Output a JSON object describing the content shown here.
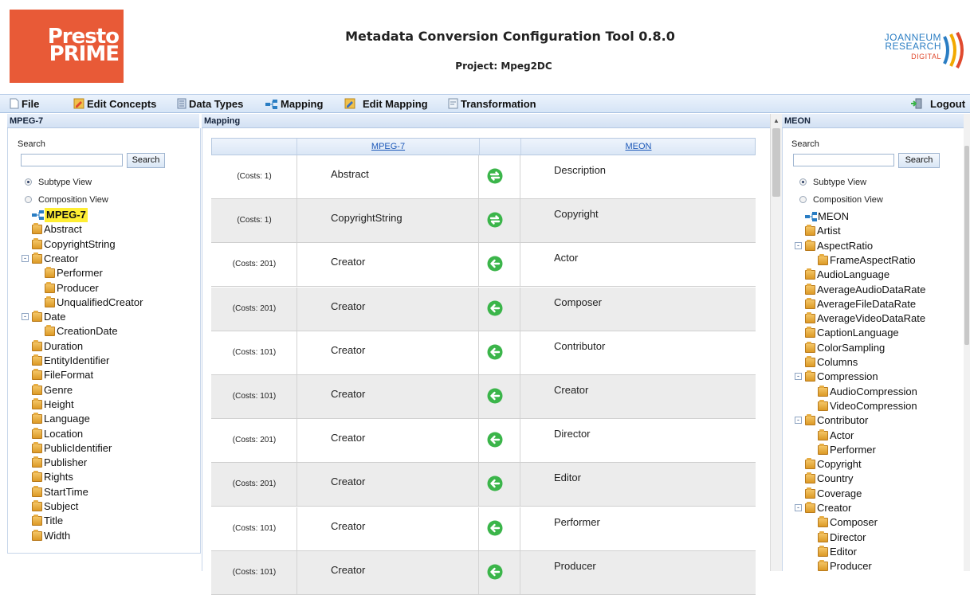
{
  "header": {
    "logo_left": [
      "Presto",
      "PRIME"
    ],
    "title": "Metadata Conversion Configuration Tool 0.8.0",
    "project": "Project: Mpeg2DC",
    "logo_right": [
      "JOANNEUM",
      "RESEARCH",
      "DIGITAL"
    ]
  },
  "toolbar": {
    "file": "File",
    "edit_concepts": "Edit Concepts",
    "data_types": "Data Types",
    "mapping": "Mapping",
    "edit_mapping": "Edit Mapping",
    "transformation": "Transformation",
    "logout": "Logout"
  },
  "left_panel": {
    "title": "MPEG-7",
    "search_label": "Search",
    "search_value": "",
    "search_button": "Search",
    "view_subtype": "Subtype View",
    "view_composition": "Composition View",
    "selected_view": "Subtype View",
    "root": "MPEG-7",
    "items": [
      {
        "label": "Abstract",
        "level": 1,
        "toggle": ""
      },
      {
        "label": "CopyrightString",
        "level": 1,
        "toggle": ""
      },
      {
        "label": "Creator",
        "level": 1,
        "toggle": "-"
      },
      {
        "label": "Performer",
        "level": 2,
        "toggle": ""
      },
      {
        "label": "Producer",
        "level": 2,
        "toggle": ""
      },
      {
        "label": "UnqualifiedCreator",
        "level": 2,
        "toggle": ""
      },
      {
        "label": "Date",
        "level": 1,
        "toggle": "-"
      },
      {
        "label": "CreationDate",
        "level": 2,
        "toggle": ""
      },
      {
        "label": "Duration",
        "level": 1,
        "toggle": ""
      },
      {
        "label": "EntityIdentifier",
        "level": 1,
        "toggle": ""
      },
      {
        "label": "FileFormat",
        "level": 1,
        "toggle": ""
      },
      {
        "label": "Genre",
        "level": 1,
        "toggle": ""
      },
      {
        "label": "Height",
        "level": 1,
        "toggle": ""
      },
      {
        "label": "Language",
        "level": 1,
        "toggle": ""
      },
      {
        "label": "Location",
        "level": 1,
        "toggle": ""
      },
      {
        "label": "PublicIdentifier",
        "level": 1,
        "toggle": ""
      },
      {
        "label": "Publisher",
        "level": 1,
        "toggle": ""
      },
      {
        "label": "Rights",
        "level": 1,
        "toggle": ""
      },
      {
        "label": "StartTime",
        "level": 1,
        "toggle": ""
      },
      {
        "label": "Subject",
        "level": 1,
        "toggle": ""
      },
      {
        "label": "Title",
        "level": 1,
        "toggle": ""
      },
      {
        "label": "Width",
        "level": 1,
        "toggle": ""
      }
    ]
  },
  "mapping_panel": {
    "title": "Mapping",
    "col_source": "MPEG-7",
    "col_target": "MEON",
    "rows": [
      {
        "cost": "(Costs: 1)",
        "source": "Abstract",
        "target": "Description",
        "kind": "bidirectional"
      },
      {
        "cost": "(Costs: 1)",
        "source": "CopyrightString",
        "target": "Copyright",
        "kind": "bidirectional"
      },
      {
        "cost": "(Costs: 201)",
        "source": "Creator",
        "target": "Actor",
        "kind": "left"
      },
      {
        "cost": "(Costs: 201)",
        "source": "Creator",
        "target": "Composer",
        "kind": "left"
      },
      {
        "cost": "(Costs: 101)",
        "source": "Creator",
        "target": "Contributor",
        "kind": "left"
      },
      {
        "cost": "(Costs: 101)",
        "source": "Creator",
        "target": "Creator",
        "kind": "left"
      },
      {
        "cost": "(Costs: 201)",
        "source": "Creator",
        "target": "Director",
        "kind": "left"
      },
      {
        "cost": "(Costs: 201)",
        "source": "Creator",
        "target": "Editor",
        "kind": "left"
      },
      {
        "cost": "(Costs: 101)",
        "source": "Creator",
        "target": "Performer",
        "kind": "left"
      },
      {
        "cost": "(Costs: 101)",
        "source": "Creator",
        "target": "Producer",
        "kind": "left"
      }
    ]
  },
  "right_panel": {
    "title": "MEON",
    "search_label": "Search",
    "search_value": "",
    "search_button": "Search",
    "view_subtype": "Subtype View",
    "view_composition": "Composition View",
    "selected_view": "Subtype View",
    "root": "MEON",
    "items": [
      {
        "label": "Artist",
        "level": 1,
        "toggle": ""
      },
      {
        "label": "AspectRatio",
        "level": 1,
        "toggle": "-"
      },
      {
        "label": "FrameAspectRatio",
        "level": 2,
        "toggle": ""
      },
      {
        "label": "AudioLanguage",
        "level": 1,
        "toggle": ""
      },
      {
        "label": "AverageAudioDataRate",
        "level": 1,
        "toggle": ""
      },
      {
        "label": "AverageFileDataRate",
        "level": 1,
        "toggle": ""
      },
      {
        "label": "AverageVideoDataRate",
        "level": 1,
        "toggle": ""
      },
      {
        "label": "CaptionLanguage",
        "level": 1,
        "toggle": ""
      },
      {
        "label": "ColorSampling",
        "level": 1,
        "toggle": ""
      },
      {
        "label": "Columns",
        "level": 1,
        "toggle": ""
      },
      {
        "label": "Compression",
        "level": 1,
        "toggle": "-"
      },
      {
        "label": "AudioCompression",
        "level": 2,
        "toggle": ""
      },
      {
        "label": "VideoCompression",
        "level": 2,
        "toggle": ""
      },
      {
        "label": "Contributor",
        "level": 1,
        "toggle": "-"
      },
      {
        "label": "Actor",
        "level": 2,
        "toggle": ""
      },
      {
        "label": "Performer",
        "level": 2,
        "toggle": ""
      },
      {
        "label": "Copyright",
        "level": 1,
        "toggle": ""
      },
      {
        "label": "Country",
        "level": 1,
        "toggle": ""
      },
      {
        "label": "Coverage",
        "level": 1,
        "toggle": ""
      },
      {
        "label": "Creator",
        "level": 1,
        "toggle": "-"
      },
      {
        "label": "Composer",
        "level": 2,
        "toggle": ""
      },
      {
        "label": "Director",
        "level": 2,
        "toggle": ""
      },
      {
        "label": "Editor",
        "level": 2,
        "toggle": ""
      },
      {
        "label": "Producer",
        "level": 2,
        "toggle": ""
      }
    ]
  },
  "colors": {
    "logo_left_bg": "#e85a37",
    "accent_blue": "#2a7dc3",
    "arrow_green": "#3bb54a",
    "highlight": "#ffee33"
  }
}
